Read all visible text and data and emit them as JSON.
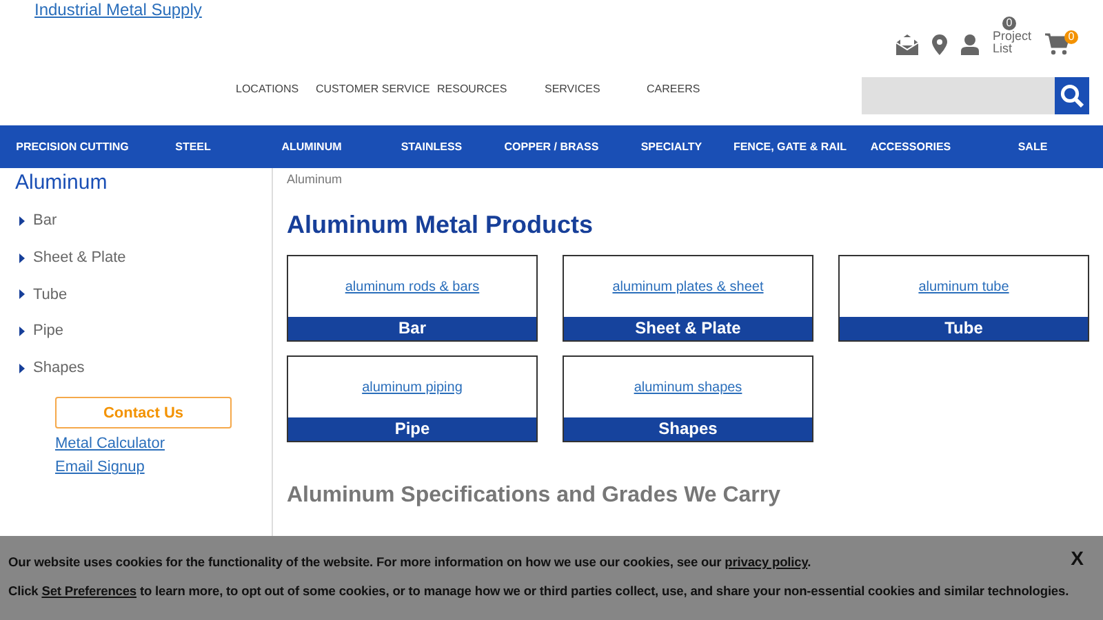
{
  "logo_link": "Industrial Metal Supply",
  "header": {
    "project_count": "0",
    "project_label": "Project List",
    "cart_count": "0"
  },
  "top_nav": [
    "LOCATIONS",
    "CUSTOMER SERVICE",
    "RESOURCES",
    "SERVICES",
    "CAREERS"
  ],
  "main_nav": [
    "PRECISION CUTTING",
    "STEEL",
    "ALUMINUM",
    "STAINLESS",
    "COPPER / BRASS",
    "SPECIALTY",
    "FENCE, GATE & RAIL",
    "ACCESSORIES",
    "SALE"
  ],
  "sidebar": {
    "title": "Aluminum",
    "items": [
      "Bar",
      "Sheet & Plate",
      "Tube",
      "Pipe",
      "Shapes"
    ],
    "contact_button": "Contact Us",
    "links": [
      "Metal Calculator",
      "Email Signup"
    ]
  },
  "breadcrumb": "Aluminum",
  "heading": "Aluminum Metal Products",
  "cards": [
    {
      "link": "aluminum rods & bars",
      "label": "Bar"
    },
    {
      "link": "aluminum plates & sheet",
      "label": "Sheet & Plate"
    },
    {
      "link": "aluminum tube",
      "label": "Tube"
    },
    {
      "link": "aluminum piping",
      "label": "Pipe"
    },
    {
      "link": "aluminum shapes",
      "label": "Shapes"
    }
  ],
  "subheading": "Aluminum Specifications and Grades We Carry",
  "cookie_banner": {
    "lines": [
      {
        "before": "Our website uses cookies for the functionality of the website. For more information on how we use our cookies, see our ",
        "link": "privacy policy",
        "after": "."
      },
      {
        "before": "Click ",
        "link": "Set Preferences",
        "after": " to learn more, to opt out of some cookies, or to manage how we or third parties collect, use, and share your non-essential cookies and similar technologies."
      }
    ],
    "close": "X"
  }
}
